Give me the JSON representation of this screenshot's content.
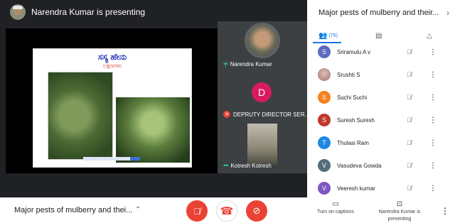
{
  "presenter": {
    "name": "Narendra Kumar is presenting"
  },
  "slide": {
    "title": "ಸಸ್ಯ ಹೇನು",
    "subtitle": "ಲಕ್ಷಣಗಳು"
  },
  "tiles": [
    {
      "name": "Narendra Kumar",
      "state": "speaking"
    },
    {
      "name": "DEPRUTY DIRECTOR SER...",
      "initial": "D",
      "color": "#d81b60",
      "state": "muted"
    },
    {
      "name": "Kotresh Kotresh",
      "state": "video"
    }
  ],
  "panel": {
    "title": "Major pests of mulberry and their...",
    "people_count": "(75)",
    "participants": [
      {
        "initial": "S",
        "name": "Sriramulu A v",
        "color": "#5c6bc0"
      },
      {
        "initial": "",
        "name": "Srushti S",
        "color": "#b08b8b"
      },
      {
        "initial": "S",
        "name": "Suchi Suchi",
        "color": "#f4811f"
      },
      {
        "initial": "S",
        "name": "Suresh Suresh",
        "color": "#c0392b"
      },
      {
        "initial": "T",
        "name": "Thulasi Ram",
        "color": "#1e88e5"
      },
      {
        "initial": "V",
        "name": "Vasudeva Gowda",
        "color": "#546e7a"
      },
      {
        "initial": "V",
        "name": "Veeresh kumar",
        "color": "#7e57c2"
      }
    ]
  },
  "bottom": {
    "meeting_title": "Major pests of mulberry and thei...",
    "captions_label": "Turn on captions",
    "presenting_label": "Narendra Kumar is presenting"
  },
  "icons": {
    "mic_off": "🎙",
    "hangup": "☎",
    "cam_off": "⊘",
    "more": "⋮",
    "chevron_up": "⌃",
    "chevron_right": "›"
  }
}
